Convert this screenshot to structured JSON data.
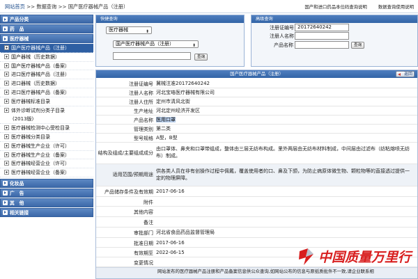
{
  "topbar": {
    "home": "网站首页",
    "sep1": ">>",
    "data_query": "数据查询",
    "sep2": ">>",
    "current": "国产医疗器械产品（注册）",
    "link_import_drug_guide": "国产和进口药品本位码查询说明",
    "link_data_query_guide": "数据查询使用说明"
  },
  "sidebar": {
    "sections": [
      {
        "head": "产品分类"
      },
      {
        "head": "药　品"
      },
      {
        "head": "医疗器械"
      }
    ],
    "items": [
      {
        "label": "国产医疗器械产品（注册）",
        "active": true
      },
      {
        "label": "国产器械（历史数据）",
        "active": false
      },
      {
        "label": "国产医疗器械产品（备案）",
        "active": false
      },
      {
        "label": "进口医疗器械产品（注册）",
        "active": false
      },
      {
        "label": "进口器械（历史数据）",
        "active": false
      },
      {
        "label": "进口医疗器械产品（备案）",
        "active": false
      },
      {
        "label": "医疗器械标准目录",
        "active": false
      },
      {
        "label": "体外诊断试剂分类子目录",
        "active": false
      },
      {
        "label": "(2013版)",
        "active": false,
        "sub": true
      },
      {
        "label": "医疗器械检测中心受检目录",
        "active": false
      },
      {
        "label": "医疗器械分类目录",
        "active": false
      },
      {
        "label": "医疗器械生产企业（许可）",
        "active": false
      },
      {
        "label": "医疗器械生产企业（备案）",
        "active": false
      },
      {
        "label": "医疗器械经营企业（许可）",
        "active": false
      },
      {
        "label": "医疗器械经营企业（备案）",
        "active": false
      }
    ],
    "bottom_sections": [
      {
        "head": "化妆品"
      },
      {
        "head": "广　告"
      },
      {
        "head": "其　他"
      },
      {
        "head": "相关链接"
      }
    ]
  },
  "quick_query": {
    "title": "快捷查询",
    "category_select": "医疗器械",
    "product_select": "国产医疗器械产品（注册）",
    "search_value": "",
    "search_button": "查询"
  },
  "advanced_query": {
    "title": "高级查询",
    "reg_no_label": "注册证编号",
    "reg_no_value": "20172640242",
    "registrant_label": "注册人名称",
    "registrant_value": "",
    "product_name_label": "产品名称",
    "product_name_value": "",
    "search_button": "查询"
  },
  "detail": {
    "title": "国产医疗器械产品（注册）",
    "back_button": "返回",
    "rows": [
      {
        "label": "注册证编号",
        "value": "冀械注准20172640242"
      },
      {
        "label": "注册人名称",
        "value": "河北宝珞医疗器械有限公司"
      },
      {
        "label": "注册人住所",
        "value": "定州市清风北街"
      },
      {
        "label": "生产地址",
        "value": "河北定州经济开发区"
      },
      {
        "label": "产品名称",
        "value": "医用口罩"
      },
      {
        "label": "管理类别",
        "value": "第二类"
      },
      {
        "label": "型号规格",
        "value": "A型，B型"
      },
      {
        "label": "结构及组成/主要组成成分",
        "value": "由口罩体、鼻夹和口罩带组成，整体由三层无纺布构成。里外两层由无纺布材料制成，中间层由过滤布（纺粘熔喷无纺布）制成。"
      },
      {
        "label": "适用范围/预期用途",
        "value": "供各类人员在非有创操作过程中佩戴，覆盖使用者的口、鼻及下颌，为防止病原体微生物、颗粒物等的直接透过提供一定的物理屏障。"
      },
      {
        "label": "产品储存条件及有效期",
        "value": "2017-06-16"
      },
      {
        "label": "附件",
        "value": ""
      },
      {
        "label": "其他内容",
        "value": ""
      },
      {
        "label": "备注",
        "value": ""
      },
      {
        "label": "审批部门",
        "value": "河北省食品药品监督管理局"
      },
      {
        "label": "批准日期",
        "value": "2017-06-16"
      },
      {
        "label": "有效期至",
        "value": "2022-06-15"
      },
      {
        "label": "变更情况",
        "value": ""
      }
    ],
    "notice": "网站发布的医疗器械产品注册和产品备案信息供公众查询,如网站公布的信息与原纸质批件不一致,请企业联系相"
  },
  "watermark": {
    "text": "中国质量万里行"
  },
  "colors": {
    "header_blue": "#3264a6",
    "active_item": "#2e5fa3",
    "watermark_red": "#d81e1e"
  }
}
